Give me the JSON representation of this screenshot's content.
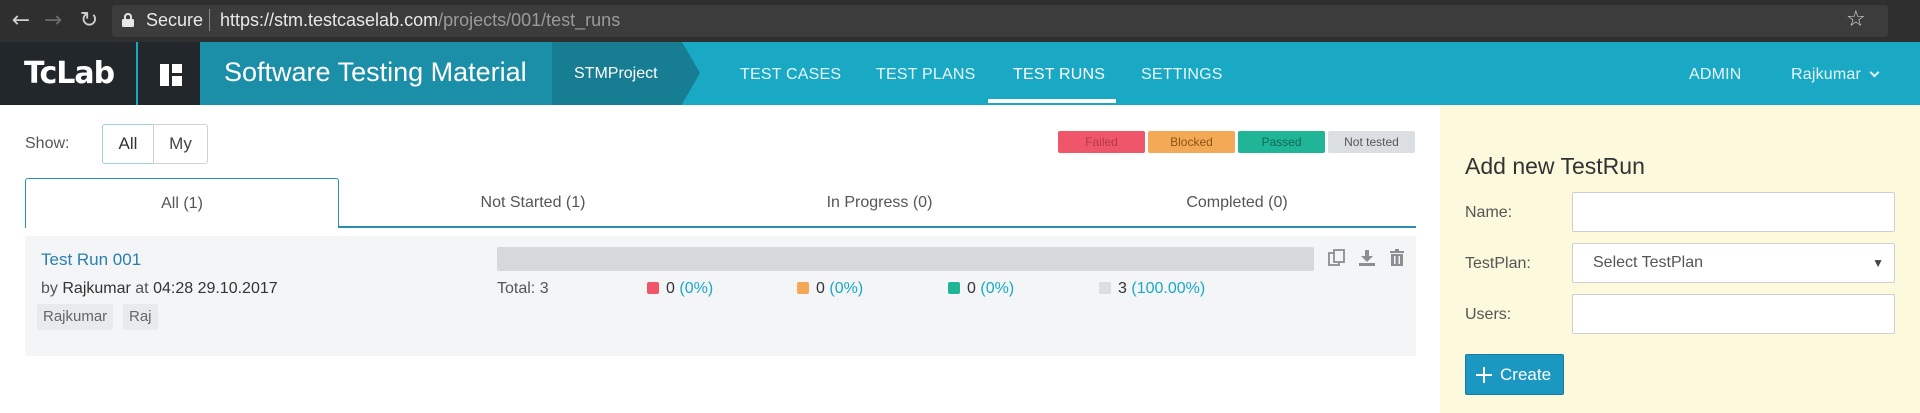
{
  "browser": {
    "security_label": "Secure",
    "url_host": "https://stm.testcaselab.com",
    "url_path": "/projects/001/test_runs"
  },
  "header": {
    "logo_text": "TcLab",
    "brand_title": "Software Testing Material",
    "project_name": "STMProject",
    "menu": [
      "TEST CASES",
      "TEST PLANS",
      "TEST RUNS",
      "SETTINGS"
    ],
    "active_menu": "TEST RUNS",
    "admin_label": "ADMIN",
    "user_name": "Rajkumar"
  },
  "filters": {
    "show_label": "Show:",
    "options": [
      "All",
      "My"
    ],
    "selected": "All"
  },
  "legend": [
    {
      "label": "Failed",
      "color": "#f0566a",
      "text_color": "#b23a4a"
    },
    {
      "label": "Blocked",
      "color": "#f4a956",
      "text_color": "#8a5518"
    },
    {
      "label": "Passed",
      "color": "#1fb596",
      "text_color": "#0f6a57"
    },
    {
      "label": "Not tested",
      "color": "#dcdfe2",
      "text_color": "#555555"
    }
  ],
  "tabs": [
    "All (1)",
    "Not Started (1)",
    "In Progress (0)",
    "Completed (0)"
  ],
  "active_tab": "All (1)",
  "run": {
    "title": "Test Run 001",
    "by_prefix": "by",
    "author": "Rajkumar",
    "at_word": "at",
    "date": "04:28 29.10.2017",
    "tags": [
      "Rajkumar",
      "Raj"
    ],
    "total_label": "Total: 3",
    "stats": [
      {
        "status": "failed",
        "count": "0",
        "pct": "(0%)",
        "color": "#f0566a"
      },
      {
        "status": "blocked",
        "count": "0",
        "pct": "(0%)",
        "color": "#f4a956"
      },
      {
        "status": "passed",
        "count": "0",
        "pct": "(0%)",
        "color": "#1fb596"
      },
      {
        "status": "not-tested",
        "count": "3",
        "pct": "(100.00%)",
        "color": "#dcdfe2"
      }
    ]
  },
  "sidebar": {
    "title": "Add new TestRun",
    "name_label": "Name:",
    "name_value": "",
    "testplan_label": "TestPlan:",
    "testplan_value": "Select TestPlan",
    "users_label": "Users:",
    "users_value": "",
    "create_label": "Create"
  }
}
